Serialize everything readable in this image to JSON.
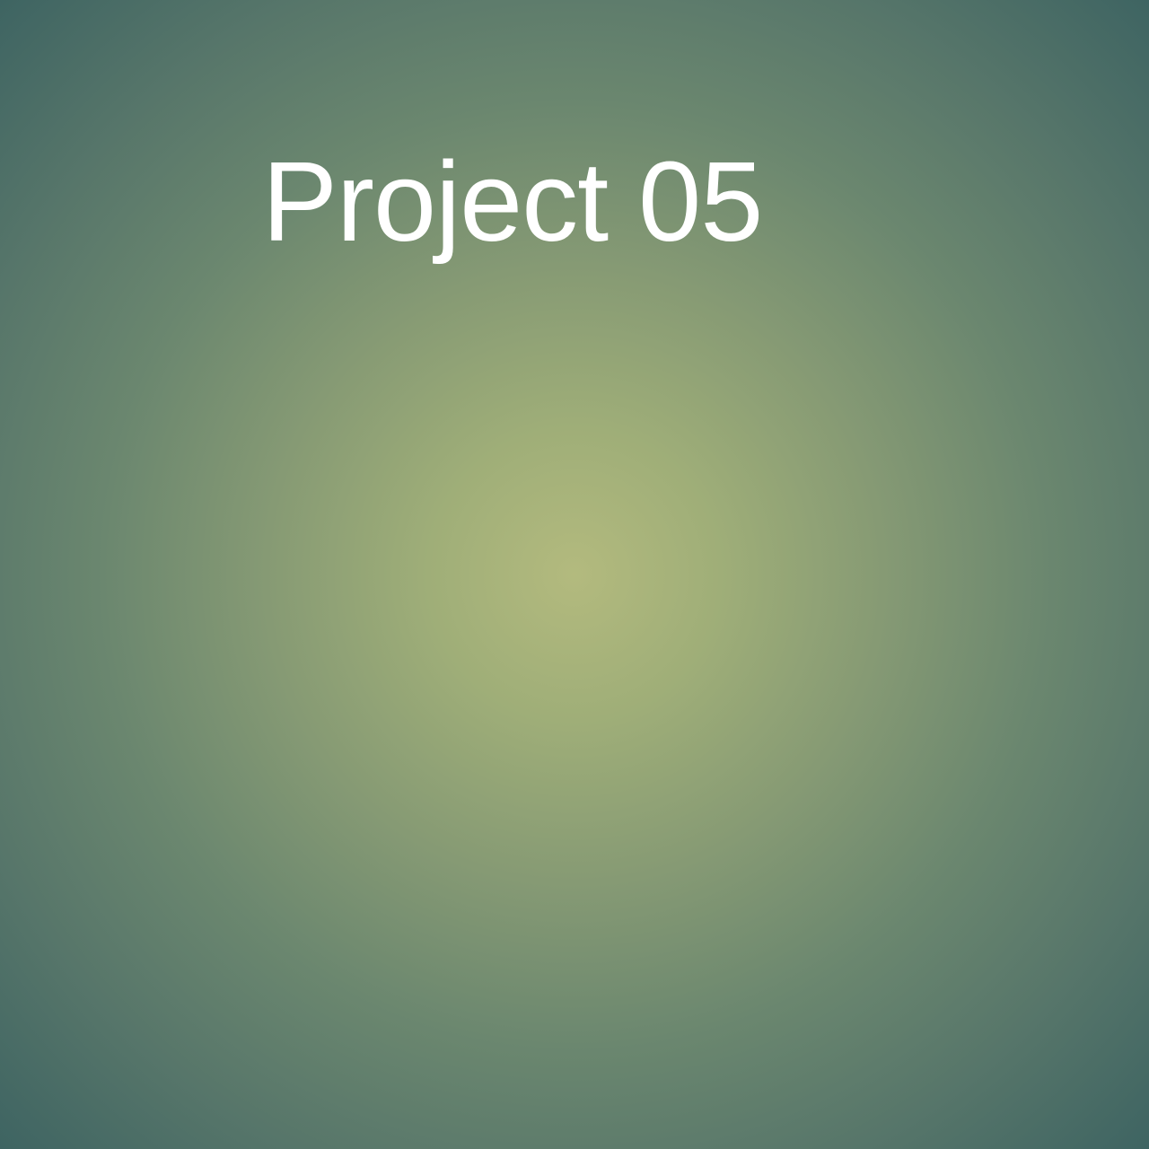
{
  "cover": {
    "title": "Project 05",
    "colors": {
      "center": "#b3ba7e",
      "edge": "#3e6462",
      "text": "#ffffff"
    }
  }
}
